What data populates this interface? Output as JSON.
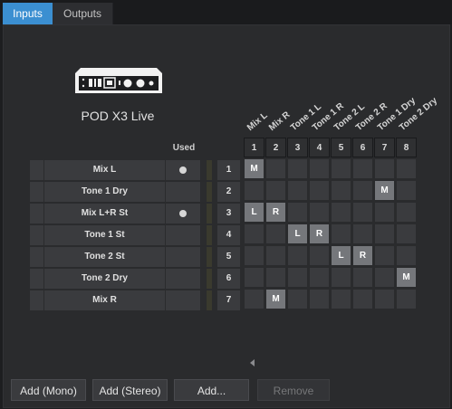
{
  "tabs": [
    {
      "label": "Inputs",
      "active": true
    },
    {
      "label": "Outputs",
      "active": false
    }
  ],
  "device": {
    "name": "POD X3 Live",
    "icon": "audio-interface-icon"
  },
  "used_header": "Used",
  "columns": [
    {
      "num": "1",
      "label": "Mix L"
    },
    {
      "num": "2",
      "label": "Mix R"
    },
    {
      "num": "3",
      "label": "Tone 1 L"
    },
    {
      "num": "4",
      "label": "Tone 1 R"
    },
    {
      "num": "5",
      "label": "Tone 2 L"
    },
    {
      "num": "6",
      "label": "Tone 2 R"
    },
    {
      "num": "7",
      "label": "Tone 1 Dry"
    },
    {
      "num": "8",
      "label": "Tone 2 Dry"
    }
  ],
  "rows": [
    {
      "name": "Mix L",
      "used": true,
      "num": "1"
    },
    {
      "name": "Tone 1 Dry",
      "used": false,
      "num": "2"
    },
    {
      "name": "Mix L+R St",
      "used": true,
      "num": "3"
    },
    {
      "name": "Tone 1 St",
      "used": false,
      "num": "4"
    },
    {
      "name": "Tone 2 St",
      "used": false,
      "num": "5"
    },
    {
      "name": "Tone 2 Dry",
      "used": false,
      "num": "6"
    },
    {
      "name": "Mix R",
      "used": false,
      "num": "7"
    }
  ],
  "assignments": [
    {
      "row": 1,
      "col": 1,
      "mark": "M"
    },
    {
      "row": 2,
      "col": 7,
      "mark": "M"
    },
    {
      "row": 3,
      "col": 1,
      "mark": "L"
    },
    {
      "row": 3,
      "col": 2,
      "mark": "R"
    },
    {
      "row": 4,
      "col": 3,
      "mark": "L"
    },
    {
      "row": 4,
      "col": 4,
      "mark": "R"
    },
    {
      "row": 5,
      "col": 5,
      "mark": "L"
    },
    {
      "row": 5,
      "col": 6,
      "mark": "R"
    },
    {
      "row": 6,
      "col": 8,
      "mark": "M"
    },
    {
      "row": 7,
      "col": 2,
      "mark": "M"
    }
  ],
  "buttons": {
    "add_mono": "Add (Mono)",
    "add_stereo": "Add (Stereo)",
    "add": "Add...",
    "remove": "Remove"
  },
  "colors": {
    "accent": "#3b8fd1"
  }
}
